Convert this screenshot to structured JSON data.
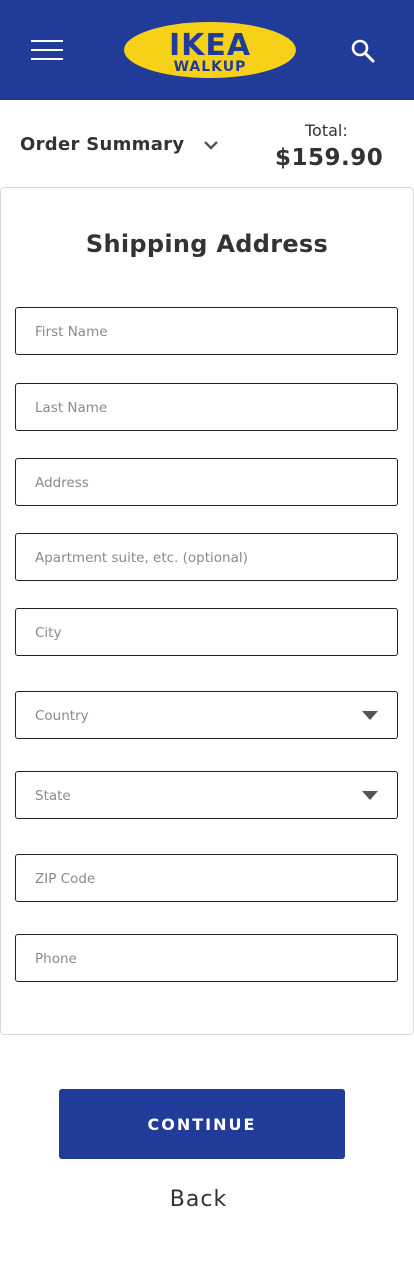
{
  "header": {
    "logo_text_top": "IKEA",
    "logo_text_bottom": "WALKUP",
    "menu_icon": "hamburger-menu-icon",
    "search_icon": "search-icon",
    "brand_blue": "#213c98",
    "brand_yellow": "#f7d117"
  },
  "summary": {
    "label": "Order Summary",
    "total_label": "Total:",
    "total_value": "$159.90"
  },
  "form": {
    "title": "Shipping Address",
    "fields": [
      {
        "placeholder": "First Name",
        "type": "text"
      },
      {
        "placeholder": "Last Name",
        "type": "text"
      },
      {
        "placeholder": "Address",
        "type": "text"
      },
      {
        "placeholder": "Apartment suite, etc. (optional)",
        "type": "text"
      },
      {
        "placeholder": "City",
        "type": "text"
      },
      {
        "placeholder": "Country",
        "type": "select"
      },
      {
        "placeholder": "State",
        "type": "select"
      },
      {
        "placeholder": "ZIP Code",
        "type": "text"
      },
      {
        "placeholder": "Phone",
        "type": "text"
      }
    ]
  },
  "actions": {
    "continue_label": "CONTINUE",
    "back_label": "Back"
  }
}
